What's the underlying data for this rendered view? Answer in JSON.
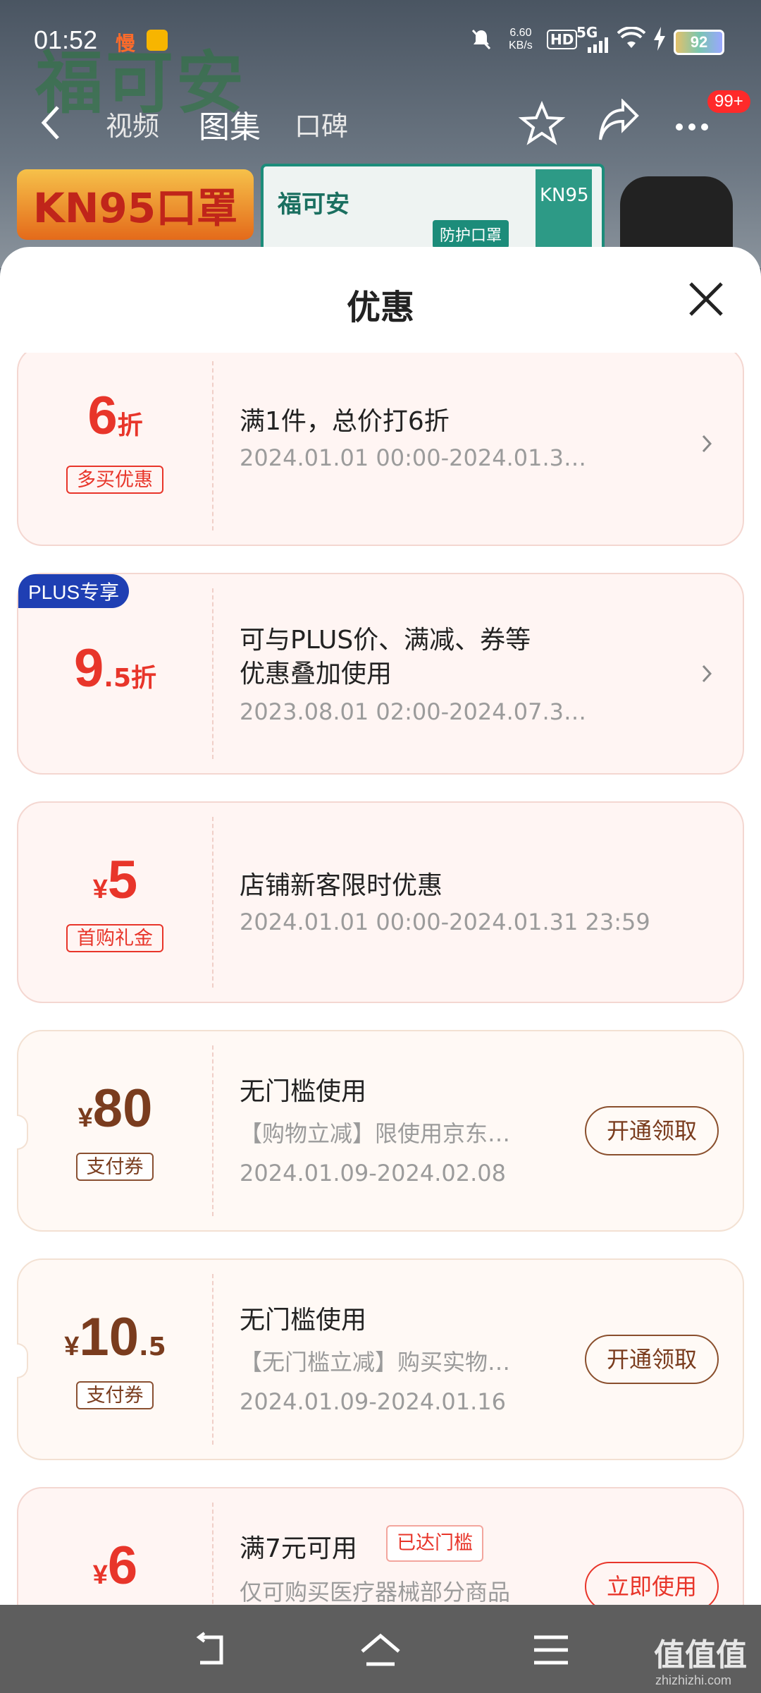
{
  "status_bar": {
    "time": "01:52",
    "slow_label": "慢",
    "speed_value": "6.60",
    "speed_unit": "KB/s",
    "hd": "HD",
    "network": "5G",
    "battery": "92"
  },
  "background": {
    "brand": "福可安",
    "kn95_label": "KN95口罩",
    "box_brand": "福可安",
    "box_tag": "防护口罩",
    "box_side": "KN95"
  },
  "nav": {
    "tabs": [
      "视频",
      "图集",
      "口碑"
    ],
    "badge": "99+"
  },
  "sheet": {
    "title": "优惠",
    "coupons": [
      {
        "amount": "6",
        "unit": "折",
        "tag": "多买优惠",
        "title": "满1件，总价打6折",
        "date": "2024.01.01 00:00-2024.01.3…"
      },
      {
        "plus_label": "PLUS专享",
        "amount_big": "9",
        "amount_small": ".5折",
        "title_line1": "可与PLUS价、满减、券等",
        "title_line2": "优惠叠加使用",
        "date": "2023.08.01 02:00-2024.07.3…"
      },
      {
        "currency": "¥",
        "amount": "5",
        "tag": "首购礼金",
        "title": "店铺新客限时优惠",
        "date": "2024.01.01 00:00-2024.01.31 23:59"
      },
      {
        "currency": "¥",
        "amount": "80",
        "tag": "支付券",
        "title": "无门槛使用",
        "desc": "【购物立减】限使用京东…",
        "date": "2024.01.09-2024.02.08",
        "button": "开通领取"
      },
      {
        "currency": "¥",
        "amount_big": "10",
        "amount_small": ".5",
        "tag": "支付券",
        "title": "无门槛使用",
        "desc": "【无门槛立减】购买实物…",
        "date": "2024.01.09-2024.01.16",
        "button": "开通领取"
      },
      {
        "currency": "¥",
        "amount": "6",
        "title": "满7元可用",
        "reached": "已达门槛",
        "desc": "仅可购买医疗器械部分商品",
        "button": "立即使用"
      }
    ]
  },
  "watermark": {
    "text": "值值值",
    "site": "zhizhizhi.com"
  },
  "colors": {
    "accent_red": "#e8352a",
    "brown": "#7a3c1e",
    "plus_blue": "#1f3fb3"
  }
}
